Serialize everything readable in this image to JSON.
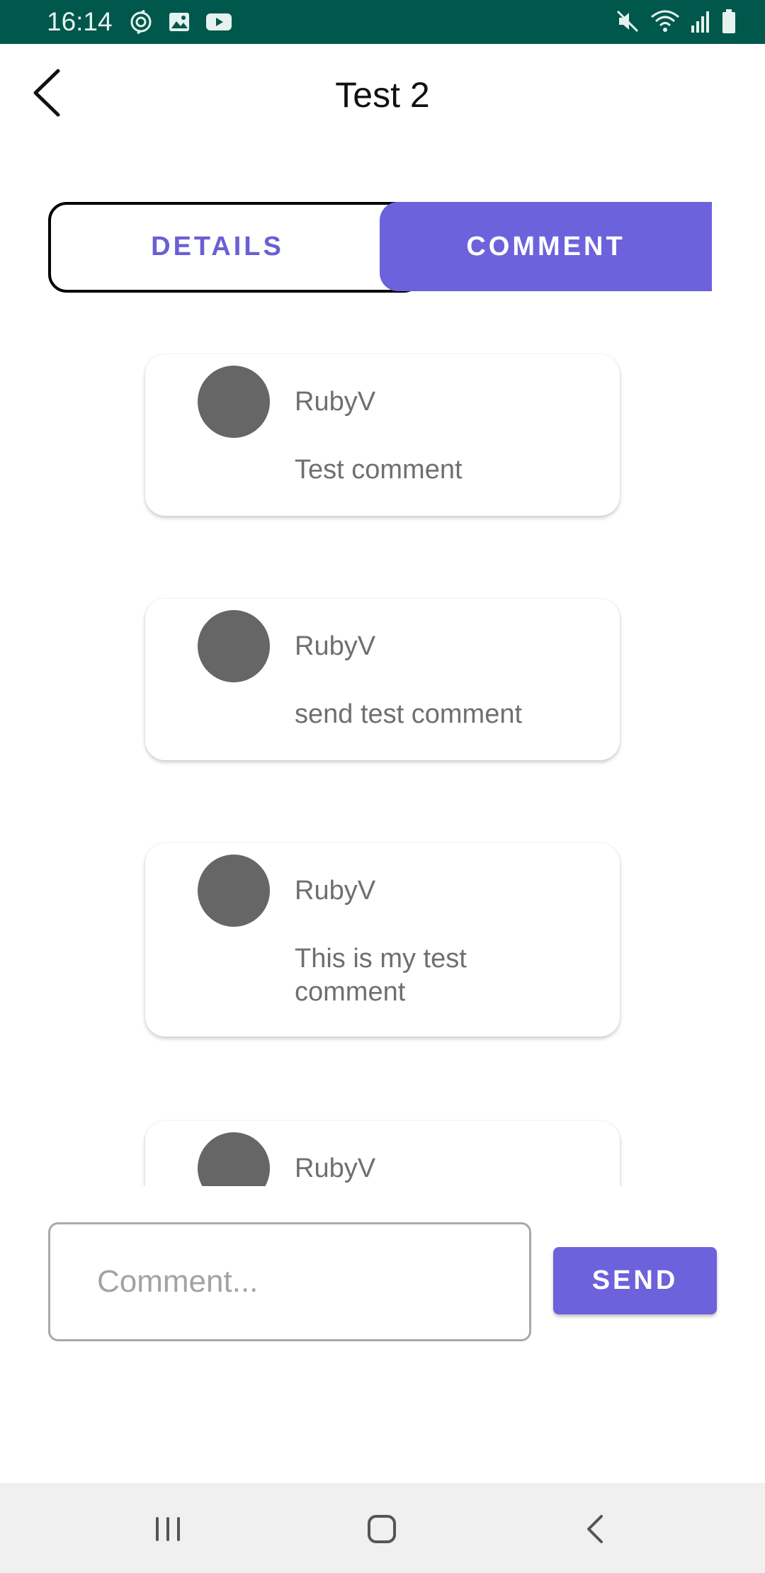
{
  "status_bar": {
    "time": "16:14",
    "left_icons": [
      "sync-icon",
      "image-icon",
      "youtube-icon"
    ],
    "right_icons": [
      "mute-icon",
      "wifi-icon",
      "signal-icon",
      "battery-icon"
    ]
  },
  "header": {
    "title": "Test 2",
    "back_icon": "chevron-left-icon"
  },
  "tabs": [
    {
      "label": "DETAILS",
      "selected": false
    },
    {
      "label": "COMMENT",
      "selected": true
    }
  ],
  "comments": [
    {
      "user": "RubyV",
      "text": "Test comment"
    },
    {
      "user": "RubyV",
      "text": "send test comment"
    },
    {
      "user": "RubyV",
      "text": "This is my test comment"
    },
    {
      "user": "RubyV",
      "text": ""
    }
  ],
  "composer": {
    "value": "",
    "placeholder": "Comment...",
    "send_label": "SEND"
  },
  "colors": {
    "status_bar": "#00574b",
    "accent": "#6c62dc",
    "avatar": "#666666"
  },
  "nav_bar": {
    "icons": [
      "recent-apps-icon",
      "home-icon",
      "back-icon"
    ]
  }
}
